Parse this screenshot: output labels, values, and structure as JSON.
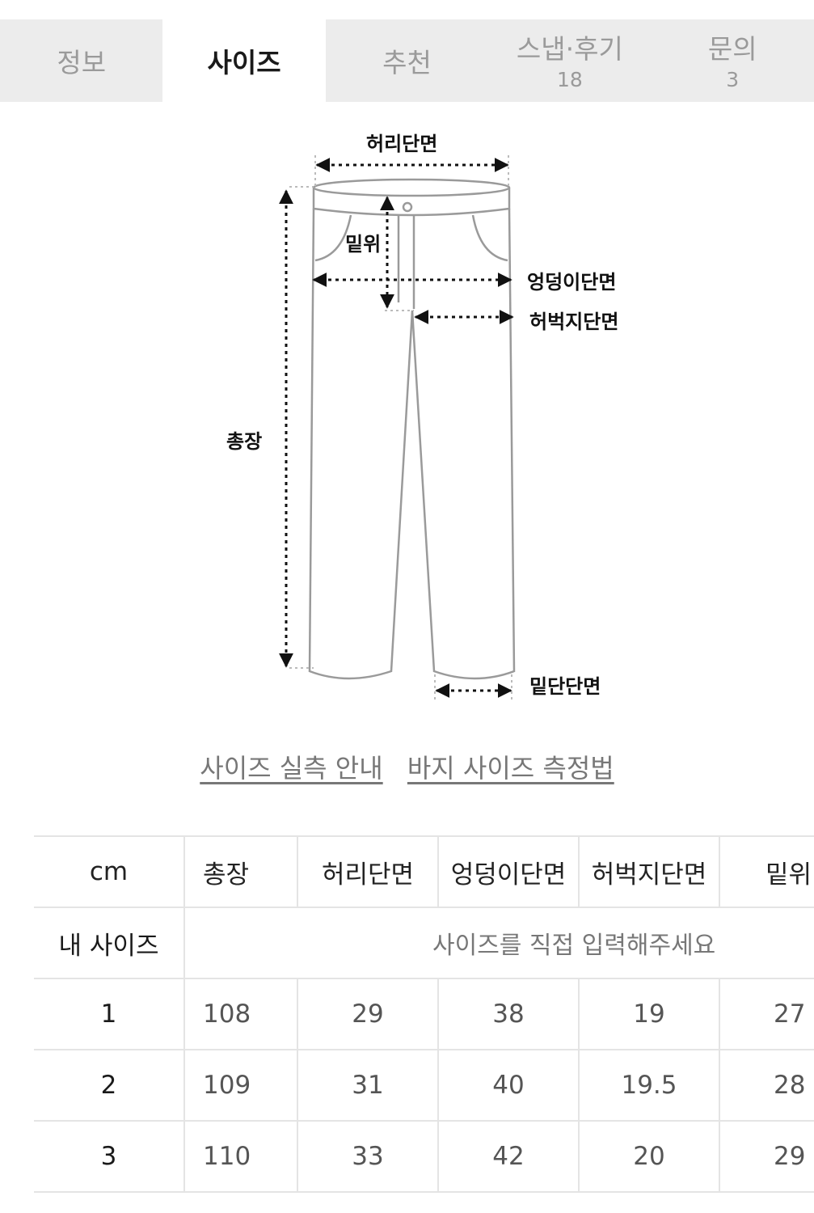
{
  "tabs": [
    {
      "label": "정보",
      "count": ""
    },
    {
      "label": "사이즈",
      "count": "",
      "active": true
    },
    {
      "label": "추천",
      "count": ""
    },
    {
      "label": "스냅·후기",
      "count": "18"
    },
    {
      "label": "문의",
      "count": "3"
    }
  ],
  "diagram": {
    "waist": "허리단면",
    "rise": "밑위",
    "hip": "엉덩이단면",
    "thigh": "허벅지단면",
    "length": "총장",
    "hem": "밑단단면"
  },
  "links": {
    "size_guide": "사이즈 실측 안내",
    "pants_measure": "바지 사이즈 측정법"
  },
  "table": {
    "unit": "cm",
    "columns": [
      "총장",
      "허리단면",
      "엉덩이단면",
      "허벅지단면",
      "밑위"
    ],
    "my_size_label": "내 사이즈",
    "my_size_placeholder": "사이즈를 직접 입력해주세요",
    "rows": [
      {
        "size": "1",
        "values": [
          "108",
          "29",
          "38",
          "19",
          "27"
        ]
      },
      {
        "size": "2",
        "values": [
          "109",
          "31",
          "40",
          "19.5",
          "28"
        ]
      },
      {
        "size": "3",
        "values": [
          "110",
          "33",
          "42",
          "20",
          "29"
        ]
      }
    ]
  }
}
